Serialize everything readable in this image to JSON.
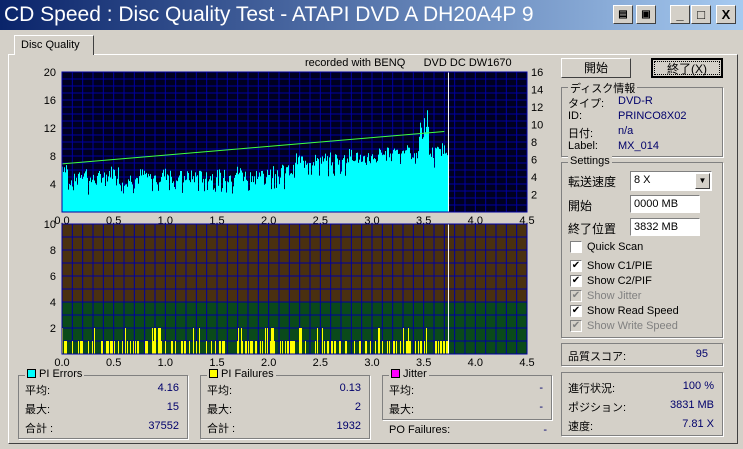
{
  "window": {
    "title": "CD Speed : Disc Quality Test - ATAPI   DVD A  DH20A4P   9",
    "buttons": [
      "minimize",
      "maximize",
      "close"
    ]
  },
  "tab": "Disc Quality",
  "recorded_with": "recorded with BENQ      DVD DC DW1670",
  "buttons": {
    "start": "開始",
    "exit": "終了(X)"
  },
  "disc_info": {
    "title": "ディスク情報",
    "type_label": "タイプ:",
    "type": "DVD-R",
    "id_label": "ID:",
    "id": "PRINCO8X02",
    "date_label": "日付:",
    "date": "n/a",
    "label_label": "Label:",
    "label": "MX_014"
  },
  "settings": {
    "title": "Settings",
    "speed_label": "転送速度",
    "speed": "8 X",
    "start_label": "開始",
    "start": "0000 MB",
    "end_label": "終了位置",
    "end": "3832 MB",
    "checks": [
      {
        "label": "Quick Scan",
        "checked": false,
        "disabled": false
      },
      {
        "label": "Show C1/PIE",
        "checked": true,
        "disabled": false
      },
      {
        "label": "Show C2/PIF",
        "checked": true,
        "disabled": false
      },
      {
        "label": "Show Jitter",
        "checked": true,
        "disabled": true
      },
      {
        "label": "Show Read Speed",
        "checked": true,
        "disabled": false
      },
      {
        "label": "Show Write Speed",
        "checked": true,
        "disabled": true
      }
    ]
  },
  "quality": {
    "label": "品質スコア:",
    "value": "95"
  },
  "progress": {
    "progress_label": "進行状況:",
    "progress": "100 %",
    "position_label": "ポジション:",
    "position": "3831 MB",
    "speed_label": "速度:",
    "speed": "7.81 X"
  },
  "pi_errors": {
    "title": "PI Errors",
    "color": "#00ffff",
    "avg_label": "平均:",
    "avg": "4.16",
    "max_label": "最大:",
    "max": "15",
    "total_label": "合計 :",
    "total": "37552"
  },
  "pi_failures": {
    "title": "PI Failures",
    "color": "#ffff00",
    "avg_label": "平均:",
    "avg": "0.13",
    "max_label": "最大:",
    "max": "2",
    "total_label": "合計 :",
    "total": "1932"
  },
  "jitter": {
    "title": "Jitter",
    "color": "#ff00ff",
    "avg_label": "平均:",
    "avg": "-",
    "max_label": "最大:",
    "max": "-"
  },
  "po_failures": {
    "label": "PO Failures:",
    "value": "-"
  },
  "chart_data": [
    {
      "type": "bar",
      "title": "PI Errors / Read Speed",
      "xlabel": "GB",
      "xlim": [
        0,
        4.5
      ],
      "ylim": [
        0,
        20
      ],
      "y2lim": [
        0,
        16
      ],
      "xticks": [
        "0.0",
        "0.5",
        "1.0",
        "1.5",
        "2.0",
        "2.5",
        "3.0",
        "3.5",
        "4.0",
        "4.5"
      ],
      "yticks": [
        "4",
        "8",
        "12",
        "16",
        "20"
      ],
      "y2ticks": [
        "2",
        "4",
        "6",
        "8",
        "10",
        "12",
        "14",
        "16"
      ],
      "x": [
        0,
        0.1,
        0.2,
        0.3,
        0.4,
        0.5,
        0.6,
        0.7,
        0.8,
        0.9,
        1.0,
        1.1,
        1.2,
        1.3,
        1.4,
        1.5,
        1.6,
        1.7,
        1.8,
        1.9,
        2.0,
        2.1,
        2.2,
        2.3,
        2.4,
        2.5,
        2.6,
        2.7,
        2.8,
        2.9,
        3.0,
        3.1,
        3.2,
        3.3,
        3.4,
        3.5,
        3.6,
        3.7
      ],
      "pie": [
        8,
        4,
        6,
        4,
        5,
        6,
        4,
        4,
        5,
        4,
        5,
        4,
        4,
        4,
        4,
        4,
        4,
        5,
        4,
        4,
        5,
        5,
        5,
        8,
        8,
        8,
        8,
        8,
        9,
        8,
        8,
        9,
        10,
        10,
        9,
        15,
        9,
        10
      ],
      "read_speed": [
        5.5,
        5.6,
        5.7,
        5.8,
        5.9,
        6.0,
        6.1,
        6.2,
        6.3,
        6.4,
        6.5,
        6.6,
        6.7,
        6.8,
        6.9,
        7.0,
        7.1,
        7.2,
        7.3,
        7.4,
        7.5,
        7.6,
        7.7,
        7.8,
        7.9,
        8.0,
        8.1,
        8.2,
        8.3,
        8.4,
        8.5,
        8.6,
        8.7,
        8.8,
        8.9,
        9.0,
        9.1,
        9.2
      ]
    },
    {
      "type": "bar",
      "title": "PI Failures",
      "xlabel": "GB",
      "xlim": [
        0,
        4.5
      ],
      "ylim": [
        0,
        10
      ],
      "threshold": 4,
      "xticks": [
        "0.0",
        "0.5",
        "1.0",
        "1.5",
        "2.0",
        "2.5",
        "3.0",
        "3.5",
        "4.0",
        "4.5"
      ],
      "yticks": [
        "2",
        "4",
        "6",
        "8",
        "10"
      ],
      "x": [
        0,
        0.1,
        0.2,
        0.3,
        0.4,
        0.5,
        0.6,
        0.7,
        0.8,
        0.9,
        1.0,
        1.1,
        1.2,
        1.3,
        1.4,
        1.5,
        1.6,
        1.7,
        1.8,
        1.9,
        2.0,
        2.1,
        2.2,
        2.3,
        2.4,
        2.5,
        2.6,
        2.7,
        2.8,
        2.9,
        3.0,
        3.1,
        3.2,
        3.3,
        3.4,
        3.5,
        3.6,
        3.7
      ],
      "pif": [
        2,
        2,
        1,
        2,
        1,
        1,
        2,
        1,
        1,
        2,
        1,
        1,
        1,
        2,
        1,
        1,
        1,
        2,
        1,
        1,
        2,
        1,
        1,
        2,
        1,
        2,
        1,
        1,
        2,
        1,
        1,
        2,
        1,
        2,
        1,
        2,
        1,
        1
      ]
    }
  ]
}
